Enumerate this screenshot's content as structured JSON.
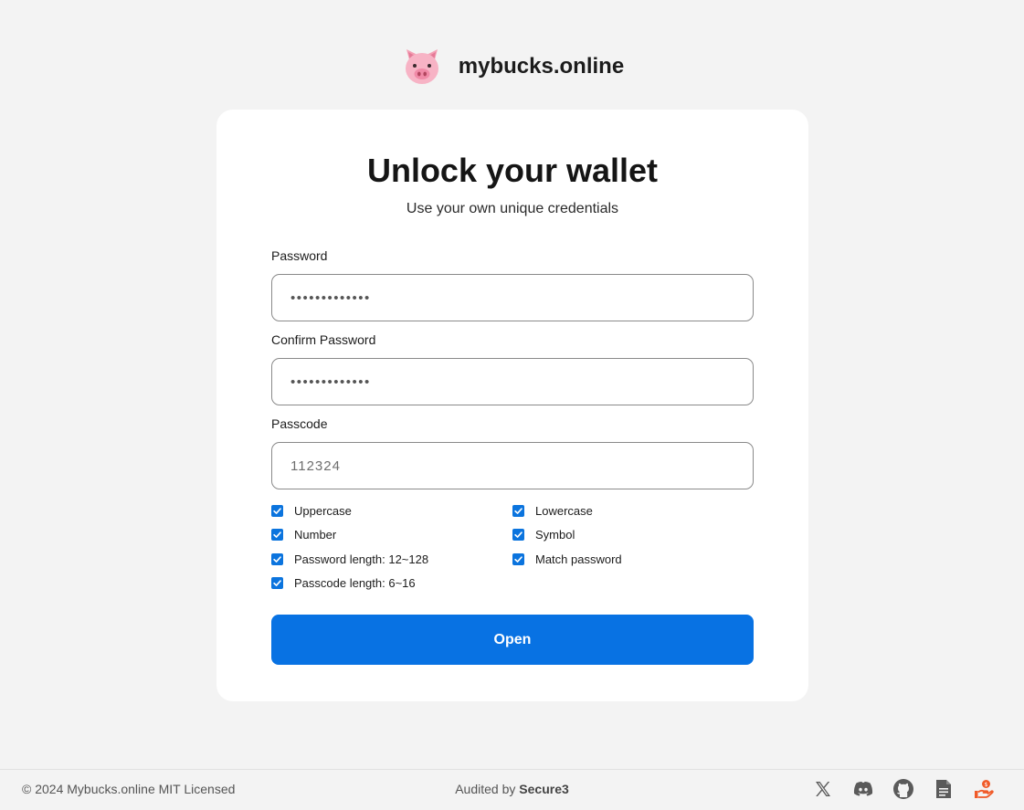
{
  "brand": {
    "name": "mybucks.online",
    "logo_icon": "pig-face-icon"
  },
  "card": {
    "title": "Unlock your wallet",
    "subtitle": "Use your own unique credentials",
    "password": {
      "label": "Password",
      "value": "•••••••••••••"
    },
    "confirm_password": {
      "label": "Confirm Password",
      "value": "•••••••••••••"
    },
    "passcode": {
      "label": "Passcode",
      "value": "112324"
    },
    "checks": [
      {
        "label": "Uppercase",
        "checked": true
      },
      {
        "label": "Lowercase",
        "checked": true
      },
      {
        "label": "Number",
        "checked": true
      },
      {
        "label": "Symbol",
        "checked": true
      },
      {
        "label": "Password length: 12~128",
        "checked": true
      },
      {
        "label": "Match password",
        "checked": true
      },
      {
        "label": "Passcode length: 6~16",
        "checked": true
      }
    ],
    "open_button": "Open"
  },
  "footer": {
    "copyright": "© 2024 Mybucks.online MIT Licensed",
    "audited_by": "Audited by",
    "auditor": "Secure3",
    "icons": [
      "x-icon",
      "discord-icon",
      "github-icon",
      "document-icon",
      "donate-icon"
    ]
  },
  "colors": {
    "accent": "#0872e3",
    "checkbox": "#0b74de",
    "background": "#f3f3f3",
    "card": "#ffffff",
    "donate": "#f05a28"
  }
}
